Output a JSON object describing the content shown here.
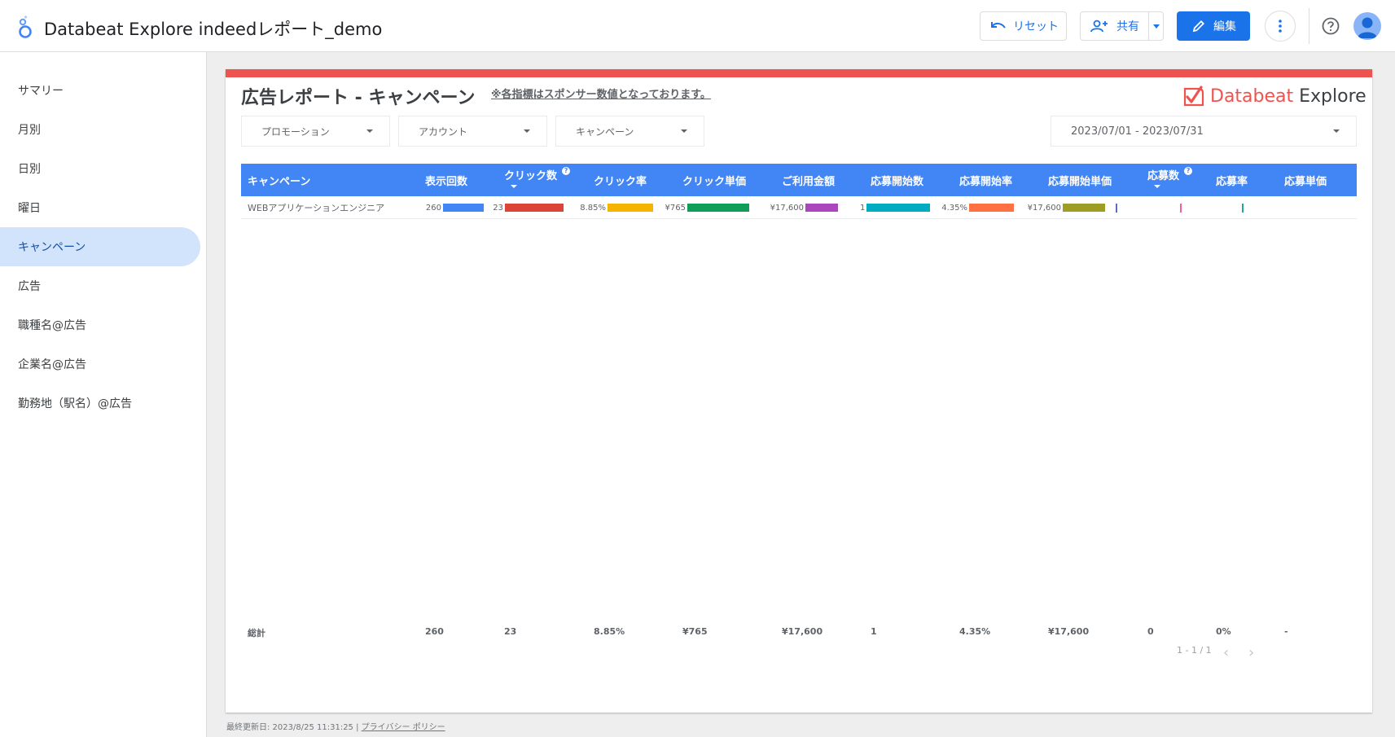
{
  "header": {
    "title": "Databeat Explore indeedレポート_demo",
    "reset_label": "リセット",
    "share_label": "共有",
    "edit_label": "編集"
  },
  "sidebar": {
    "items": [
      {
        "label": "サマリー",
        "active": false
      },
      {
        "label": "月別",
        "active": false
      },
      {
        "label": "日別",
        "active": false
      },
      {
        "label": "曜日",
        "active": false
      },
      {
        "label": "キャンペーン",
        "active": true
      },
      {
        "label": "広告",
        "active": false
      },
      {
        "label": "職種名@広告",
        "active": false
      },
      {
        "label": "企業名@広告",
        "active": false
      },
      {
        "label": "勤務地（駅名）@広告",
        "active": false
      }
    ]
  },
  "report": {
    "title": "広告レポート - キャンペーン",
    "note": "※各指標はスポンサー数値となっております。",
    "brand_part1": "Databeat",
    "brand_part2": "Explore",
    "filters": {
      "promotion": "プロモーション",
      "account": "アカウント",
      "campaign": "キャンペーン",
      "date_range": "2023/07/01 - 2023/07/31"
    },
    "table": {
      "columns": [
        "キャンペーン",
        "表示回数",
        "クリック数",
        "クリック率",
        "クリック単価",
        "ご利用金額",
        "応募開始数",
        "応募開始率",
        "応募開始単価",
        "応募数",
        "応募率",
        "応募単価"
      ],
      "rows": [
        {
          "campaign": "WEBアプリケーションエンジニア",
          "impressions": "260",
          "clicks": "23",
          "ctr": "8.85%",
          "cpc": "¥765",
          "cost": "¥17,600",
          "apply_starts": "1",
          "apply_start_rate": "4.35%",
          "apply_start_cpa": "¥17,600"
        }
      ],
      "totals": {
        "label": "総計",
        "impressions": "260",
        "clicks": "23",
        "ctr": "8.85%",
        "cpc": "¥765",
        "cost": "¥17,600",
        "apply_starts": "1",
        "apply_start_rate": "4.35%",
        "apply_start_cpa": "¥17,600",
        "applications": "0",
        "apply_rate": "0%",
        "apply_cpa": "-"
      },
      "bar_colors": [
        "#4285f4",
        "#db4437",
        "#f4b400",
        "#0f9d58",
        "#ab47bc",
        "#00acc1",
        "#ff7043",
        "#9e9d24",
        "#5c6bc0",
        "#f06292",
        "#26a69a"
      ],
      "pagination": "1 - 1 / 1"
    }
  },
  "footer": {
    "last_updated": "最終更新日: 2023/8/25 11:31:25",
    "privacy": "プライバシー ポリシー"
  }
}
